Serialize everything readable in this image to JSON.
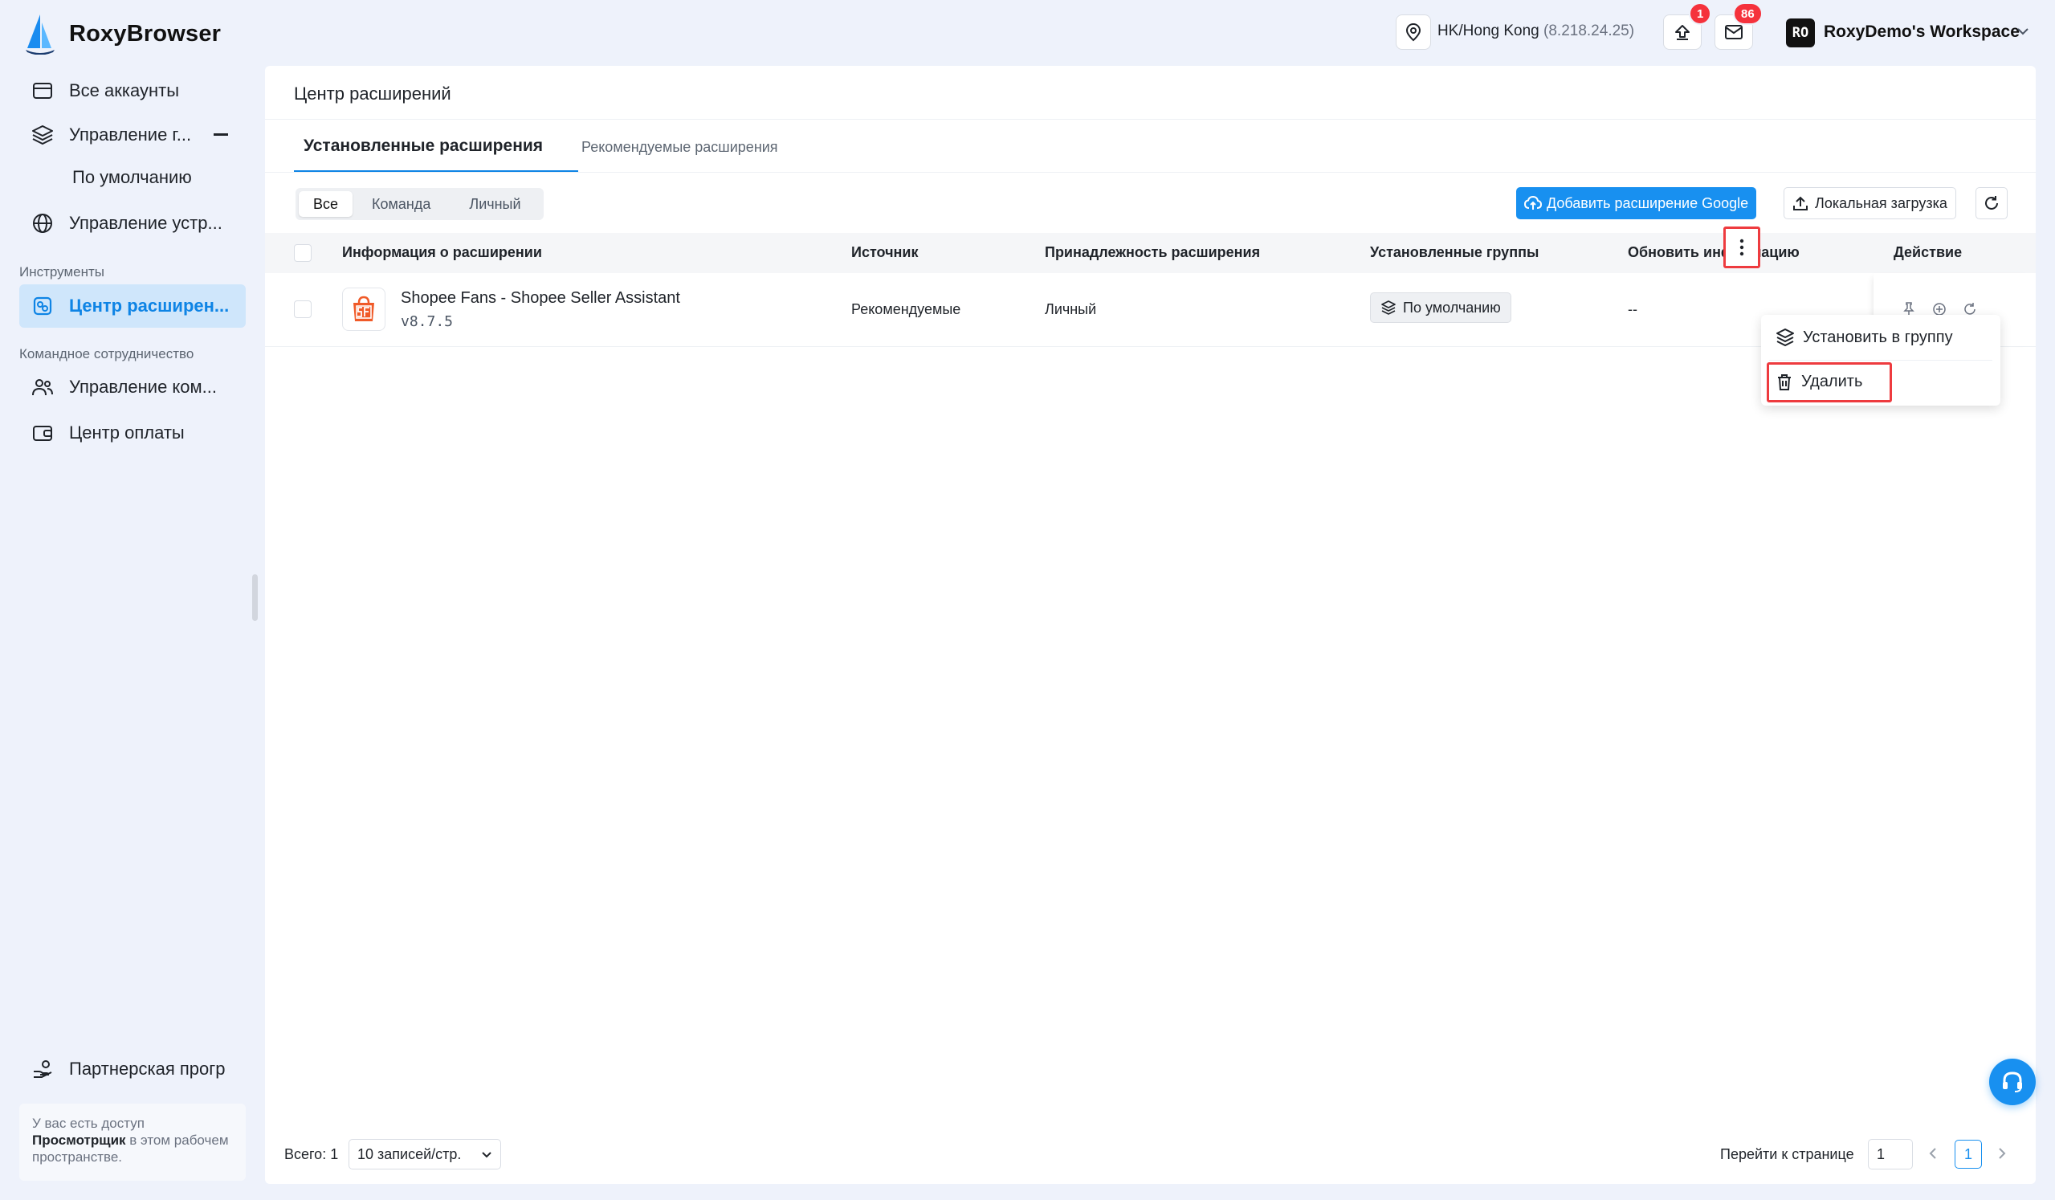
{
  "app": {
    "name": "RoxyBrowser"
  },
  "sidebar": {
    "items": [
      {
        "label": "Все аккаунты",
        "icon": "accounts-icon"
      },
      {
        "label": "Управление г...",
        "icon": "layers-icon"
      },
      {
        "label": "Управление устр...",
        "icon": "globe-icon"
      }
    ],
    "sub_items": [
      {
        "label": "По умолчанию"
      }
    ],
    "sections": [
      {
        "label": "Инструменты",
        "items": [
          {
            "label": "Центр расширен...",
            "icon": "extension-icon",
            "active": true
          }
        ]
      },
      {
        "label": "Командное сотрудничество",
        "items": [
          {
            "label": "Управление ком...",
            "icon": "team-icon"
          },
          {
            "label": "Центр оплаты",
            "icon": "wallet-icon"
          }
        ]
      }
    ],
    "partner": {
      "label": "Партнерская прогр",
      "icon": "partner-icon"
    },
    "viewer_note": {
      "prefix": "У вас есть доступ",
      "role": "Просмотрщик",
      "suffix": " в этом рабочем пространстве."
    }
  },
  "topbar": {
    "location": "HK/Hong Kong",
    "ip": "(8.218.24.25)",
    "upload_badge": "1",
    "mail_badge": "86",
    "workspace_initials": "RO",
    "workspace_name": "RoxyDemo's Workspace"
  },
  "page": {
    "title": "Центр расширений",
    "tabs": [
      {
        "label": "Установленные расширения",
        "active": true
      },
      {
        "label": "Рекомендуемые расширения",
        "active": false
      }
    ],
    "filters": [
      {
        "label": "Все",
        "active": true
      },
      {
        "label": "Команда"
      },
      {
        "label": "Личный"
      }
    ],
    "buttons": {
      "add_google": "Добавить расширение Google",
      "local_upload": "Локальная загрузка"
    }
  },
  "table": {
    "columns": [
      "Информация о расширении",
      "Источник",
      "Принадлежность расширения",
      "Установленные группы",
      "Обновить информацию",
      "Действие"
    ],
    "rows": [
      {
        "name": "Shopee Fans - Shopee Seller Assistant",
        "version": "v8.7.5",
        "source": "Рекомендуемые",
        "ownership": "Личный",
        "group": "По умолчанию",
        "update_info": "--",
        "icon_color": "#f05a28"
      }
    ]
  },
  "menu": {
    "items": [
      {
        "label": "Установить в группу",
        "icon": "layers-icon"
      },
      {
        "label": "Удалить",
        "icon": "trash-icon"
      }
    ]
  },
  "pagination": {
    "total": "Всего: 1",
    "page_size": "10 записей/стр.",
    "goto_label": "Перейти к странице",
    "goto_value": "1",
    "current_page": "1"
  },
  "colors": {
    "accent": "#1890f0",
    "active_nav_bg": "#cfe6fb",
    "highlight": "#ee3b3f",
    "badge": "#f5323c"
  }
}
